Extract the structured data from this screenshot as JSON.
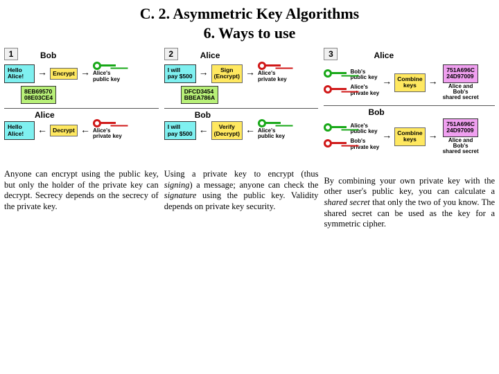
{
  "title": {
    "line1": "C. 2. Asymmetric Key Algorithms",
    "line2": "6. Ways to use"
  },
  "panel1": {
    "num": "1",
    "ownerTop": "Bob",
    "msg1": "Hello\nAlice!",
    "op1": "Encrypt",
    "key1": "Alice's\npublic key",
    "cipher": "8EB69570\n08E03CE4",
    "ownerBottom": "Alice",
    "msg2": "Hello\nAlice!",
    "op2": "Decrypt",
    "key2": "Alice's\nprivate key",
    "caption": "Anyone can encrypt using the public key, but only the holder of the private key can decrypt. Secrecy depends on the secrecy of the private key."
  },
  "panel2": {
    "num": "2",
    "ownerTop": "Alice",
    "msg1": "I will\npay $500",
    "op1": "Sign\n(Encrypt)",
    "key1": "Alice's\nprivate key",
    "cipher": "DFCD3454\nBBEA786A",
    "ownerBottom": "Bob",
    "msg2": "I will\npay $500",
    "op2": "Verify\n(Decrypt)",
    "key2": "Alice's\npublic key",
    "caption_pre": "Using a private key to encrypt (thus ",
    "caption_sig": "signing",
    "caption_mid": ") a message; anyone can check the ",
    "caption_sig2": "signature",
    "caption_post": " using the public key. Validity depends on private key security."
  },
  "panel3": {
    "num": "3",
    "ownerTop": "Alice",
    "key1a": "Bob's\npublic key",
    "key1b": "Alice's\nprivate key",
    "op": "Combine\nkeys",
    "secret": "751A696C\n24D97009",
    "secretLabel": "Alice and Bob's\nshared secret",
    "ownerBottom": "Bob",
    "key2a": "Alice's\npublic key",
    "key2b": "Bob's\nprivate key",
    "caption_pre": "By combining your own private key with the other user's public key, you can calculate a ",
    "caption_em": "shared secret",
    "caption_post": " that only the two of you know. The shared secret can be used as the key for a symmetric cipher."
  }
}
